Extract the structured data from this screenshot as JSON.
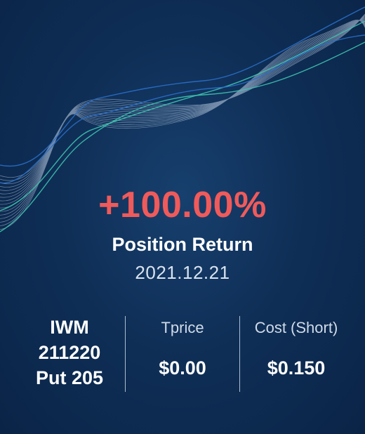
{
  "return": {
    "value": "+100.00%",
    "label": "Position Return",
    "date": "2021.12.21"
  },
  "position": {
    "symbol_line1": "IWM",
    "symbol_line2": "211220",
    "symbol_line3": "Put 205"
  },
  "stats": {
    "tprice_label": "Tprice",
    "tprice_value": "$0.00",
    "cost_label": "Cost (Short)",
    "cost_value": "$0.150"
  },
  "colors": {
    "background": "#0f2f57",
    "return_positive": "#f05a5a",
    "wave_teal": "#3fc4b0",
    "wave_blue": "#2a6fc9",
    "wave_white": "#c7d6ea"
  }
}
